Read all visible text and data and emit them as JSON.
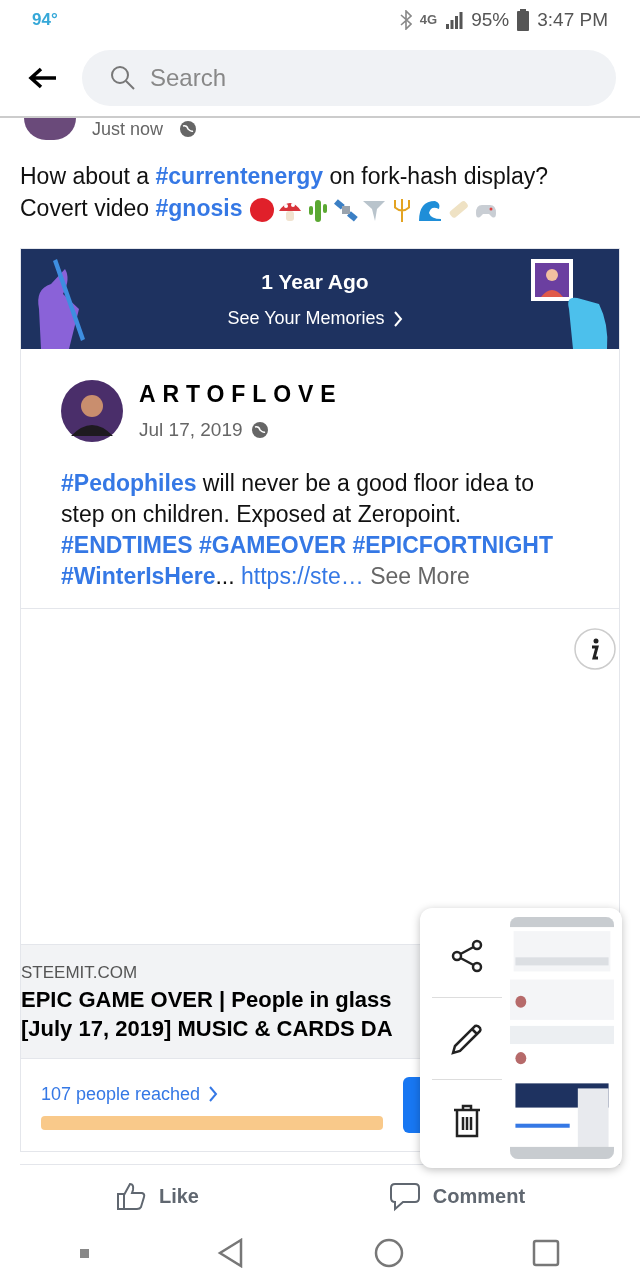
{
  "status_bar": {
    "temperature": "94°",
    "network": "4G",
    "battery": "95%",
    "time": "3:47 PM"
  },
  "search": {
    "placeholder": "Search"
  },
  "post": {
    "time": "Just now",
    "text": "How about a **#currentenergy** on fork-hash display? Covert video **#gnosis**",
    "emojis": [
      {
        "kind": "red-circle"
      },
      {
        "kind": "mushroom"
      },
      {
        "kind": "cactus"
      },
      {
        "kind": "satellite"
      },
      {
        "kind": "tornado"
      },
      {
        "kind": "trident"
      },
      {
        "kind": "wave"
      },
      {
        "kind": "scroll"
      },
      {
        "kind": "gamepad"
      }
    ]
  },
  "memory": {
    "title": "1 Year Ago",
    "link": "See Your Memories"
  },
  "shared_post": {
    "author": "ARTOFLOVE",
    "date": "Jul 17, 2019",
    "text": "**#Pedophiles** will never be a good floor idea to step on children. Exposed at Zeropoint. **#ENDTIMES #GAMEOVER #EPICFORTNIGHT #WinterIsHere**...",
    "link": "https://ste…",
    "see_more": "See More"
  },
  "link_preview": {
    "domain": "STEEMIT.COM",
    "title_lines": [
      "EPIC GAME OVER | People in glass",
      "[July 17, 2019] MUSIC & CARDS DA"
    ]
  },
  "reach": {
    "label": "107 people reached"
  },
  "actions": [
    {
      "kind": "like",
      "label": "Like"
    },
    {
      "kind": "comment",
      "label": "Comment"
    }
  ],
  "screenshot_popup": {
    "actions": [
      {
        "kind": "share"
      },
      {
        "kind": "edit"
      },
      {
        "kind": "delete"
      }
    ]
  }
}
